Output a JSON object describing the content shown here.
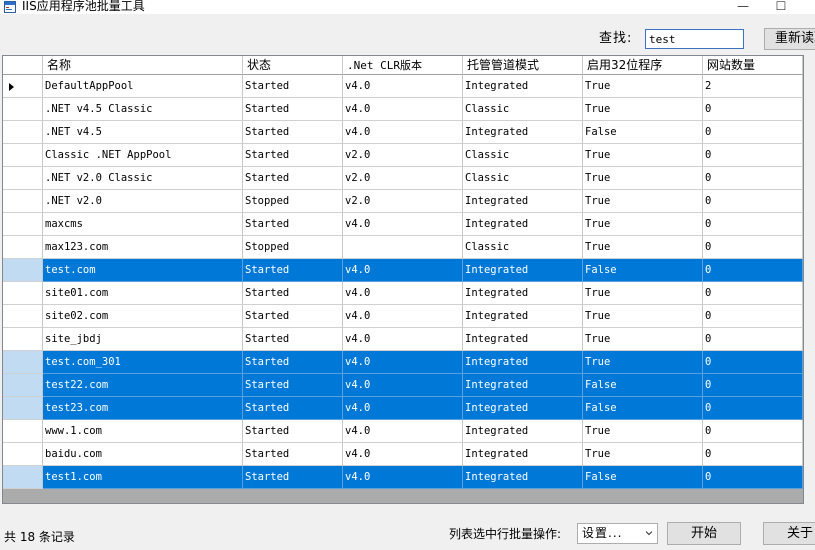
{
  "window": {
    "title": "IIS应用程序池批量工具",
    "minimize_label": "—",
    "maximize_label": "☐"
  },
  "search": {
    "label": "查找:",
    "value": "test",
    "reload_label": "重新读取"
  },
  "grid": {
    "columns": [
      "名称",
      "状态",
      ".Net CLR版本",
      "托管管道模式",
      "启用32位程序",
      "网站数量"
    ],
    "rows": [
      {
        "selected": false,
        "current": true,
        "cells": [
          "DefaultAppPool",
          "Started",
          "v4.0",
          "Integrated",
          "True",
          "2"
        ]
      },
      {
        "selected": false,
        "current": false,
        "cells": [
          ".NET v4.5 Classic",
          "Started",
          "v4.0",
          "Classic",
          "True",
          "0"
        ]
      },
      {
        "selected": false,
        "current": false,
        "cells": [
          ".NET v4.5",
          "Started",
          "v4.0",
          "Integrated",
          "False",
          "0"
        ]
      },
      {
        "selected": false,
        "current": false,
        "cells": [
          "Classic .NET AppPool",
          "Started",
          "v2.0",
          "Classic",
          "True",
          "0"
        ]
      },
      {
        "selected": false,
        "current": false,
        "cells": [
          ".NET v2.0 Classic",
          "Started",
          "v2.0",
          "Classic",
          "True",
          "0"
        ]
      },
      {
        "selected": false,
        "current": false,
        "cells": [
          ".NET v2.0",
          "Stopped",
          "v2.0",
          "Integrated",
          "True",
          "0"
        ]
      },
      {
        "selected": false,
        "current": false,
        "cells": [
          "maxcms",
          "Started",
          "v4.0",
          "Integrated",
          "True",
          "0"
        ]
      },
      {
        "selected": false,
        "current": false,
        "cells": [
          "max123.com",
          "Stopped",
          "",
          "Classic",
          "True",
          "0"
        ]
      },
      {
        "selected": true,
        "current": false,
        "cells": [
          "test.com",
          "Started",
          "v4.0",
          "Integrated",
          "False",
          "0"
        ]
      },
      {
        "selected": false,
        "current": false,
        "cells": [
          "site01.com",
          "Started",
          "v4.0",
          "Integrated",
          "True",
          "0"
        ]
      },
      {
        "selected": false,
        "current": false,
        "cells": [
          "site02.com",
          "Started",
          "v4.0",
          "Integrated",
          "True",
          "0"
        ]
      },
      {
        "selected": false,
        "current": false,
        "cells": [
          "site_jbdj",
          "Started",
          "v4.0",
          "Integrated",
          "True",
          "0"
        ]
      },
      {
        "selected": true,
        "current": false,
        "cells": [
          "test.com_301",
          "Started",
          "v4.0",
          "Integrated",
          "True",
          "0"
        ]
      },
      {
        "selected": true,
        "current": false,
        "cells": [
          "test22.com",
          "Started",
          "v4.0",
          "Integrated",
          "False",
          "0"
        ]
      },
      {
        "selected": true,
        "current": false,
        "cells": [
          "test23.com",
          "Started",
          "v4.0",
          "Integrated",
          "False",
          "0"
        ]
      },
      {
        "selected": false,
        "current": false,
        "cells": [
          "www.1.com",
          "Started",
          "v4.0",
          "Integrated",
          "True",
          "0"
        ]
      },
      {
        "selected": false,
        "current": false,
        "cells": [
          "baidu.com",
          "Started",
          "v4.0",
          "Integrated",
          "True",
          "0"
        ]
      },
      {
        "selected": true,
        "current": false,
        "cells": [
          "test1.com",
          "Started",
          "v4.0",
          "Integrated",
          "False",
          "0"
        ]
      }
    ]
  },
  "footer": {
    "record_count": "共 18 条记录",
    "batch_label": "列表选中行批量操作:",
    "operation_selected": "设置...",
    "start_label": "开始",
    "about_label": "关于"
  },
  "colors": {
    "selection": "#0078d7",
    "selection_row_header": "#c1dcf2",
    "grid_background": "#ababab",
    "window_background": "#f0f0f0"
  },
  "icons": {
    "app": "app-window-icon",
    "row_pointer": "row-pointer-icon",
    "dropdown": "chevron-down-icon"
  }
}
